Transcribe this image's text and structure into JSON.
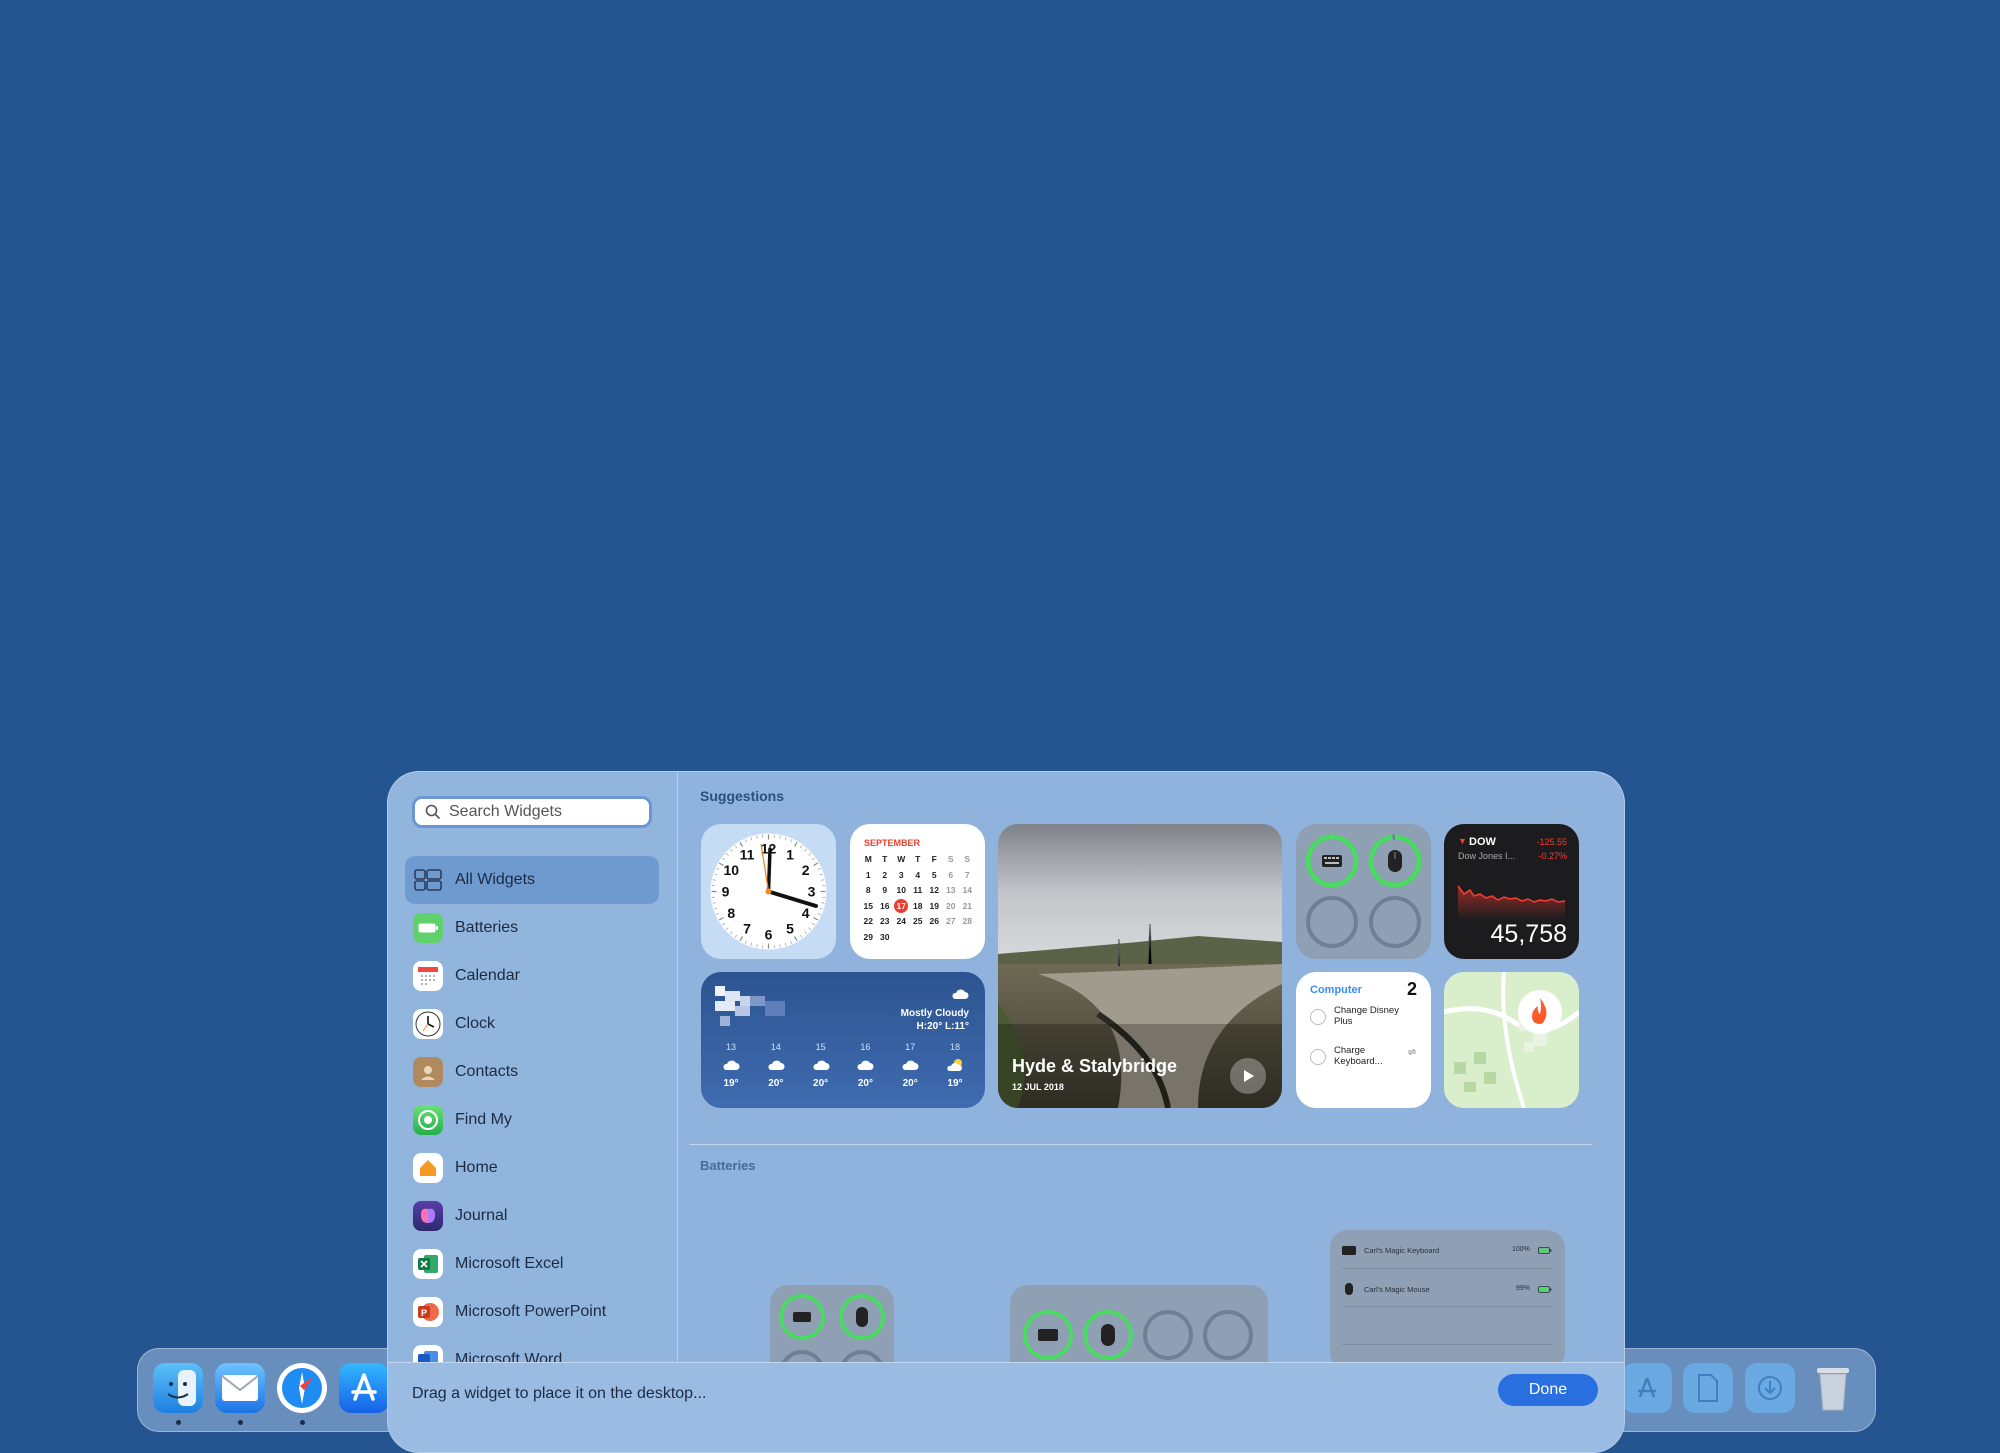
{
  "panel": {
    "search_placeholder": "Search Widgets",
    "sidebar_items": [
      {
        "label": "All Widgets"
      },
      {
        "label": "Batteries"
      },
      {
        "label": "Calendar"
      },
      {
        "label": "Clock"
      },
      {
        "label": "Contacts"
      },
      {
        "label": "Find My"
      },
      {
        "label": "Home"
      },
      {
        "label": "Journal"
      },
      {
        "label": "Microsoft Excel"
      },
      {
        "label": "Microsoft PowerPoint"
      },
      {
        "label": "Microsoft Word"
      }
    ],
    "suggestions_title": "Suggestions",
    "batteries_title": "Batteries",
    "footer_text": "Drag a widget to place it on the desktop...",
    "done_label": "Done"
  },
  "widgets": {
    "calendar": {
      "month": "SEPTEMBER",
      "weekdays": [
        "M",
        "T",
        "W",
        "T",
        "F",
        "S",
        "S"
      ],
      "weeks": [
        [
          "1",
          "2",
          "3",
          "4",
          "5",
          "6",
          "7"
        ],
        [
          "8",
          "9",
          "10",
          "11",
          "12",
          "13",
          "14"
        ],
        [
          "15",
          "16",
          "17",
          "18",
          "19",
          "20",
          "21"
        ],
        [
          "22",
          "23",
          "24",
          "25",
          "26",
          "27",
          "28"
        ],
        [
          "29",
          "30",
          "",
          "",
          "",
          "",
          ""
        ]
      ],
      "today": "17"
    },
    "clock": {
      "numbers": [
        "12",
        "1",
        "2",
        "3",
        "4",
        "5",
        "6",
        "7",
        "8",
        "9",
        "10",
        "11"
      ]
    },
    "weather": {
      "condition": "Mostly Cloudy",
      "hilo": "H:20° L:11°",
      "days": [
        "13",
        "14",
        "15",
        "16",
        "17",
        "18"
      ],
      "temps": [
        "19°",
        "20°",
        "20°",
        "20°",
        "20°",
        "19°"
      ]
    },
    "photo": {
      "title": "Hyde & Stalybridge",
      "date": "12 JUL 2018"
    },
    "stock": {
      "symbol": "DOW",
      "name": "Dow Jones I...",
      "change": "-125.55",
      "change_pct": "-0.27%",
      "price": "45,758"
    },
    "reminders": {
      "list": "Computer",
      "count": "2",
      "items": [
        "Change Disney Plus",
        "Charge Keyboard..."
      ]
    },
    "battery_list": {
      "rows": [
        {
          "name": "Carl's Magic Keyboard",
          "pct": "100%"
        },
        {
          "name": "Carl's Magic Mouse",
          "pct": "99%"
        }
      ]
    }
  },
  "colors": {
    "desktop": "#245590",
    "accent": "#2a6fe0",
    "battery_green": "#4cd964",
    "stock_red": "#ff3b30"
  }
}
